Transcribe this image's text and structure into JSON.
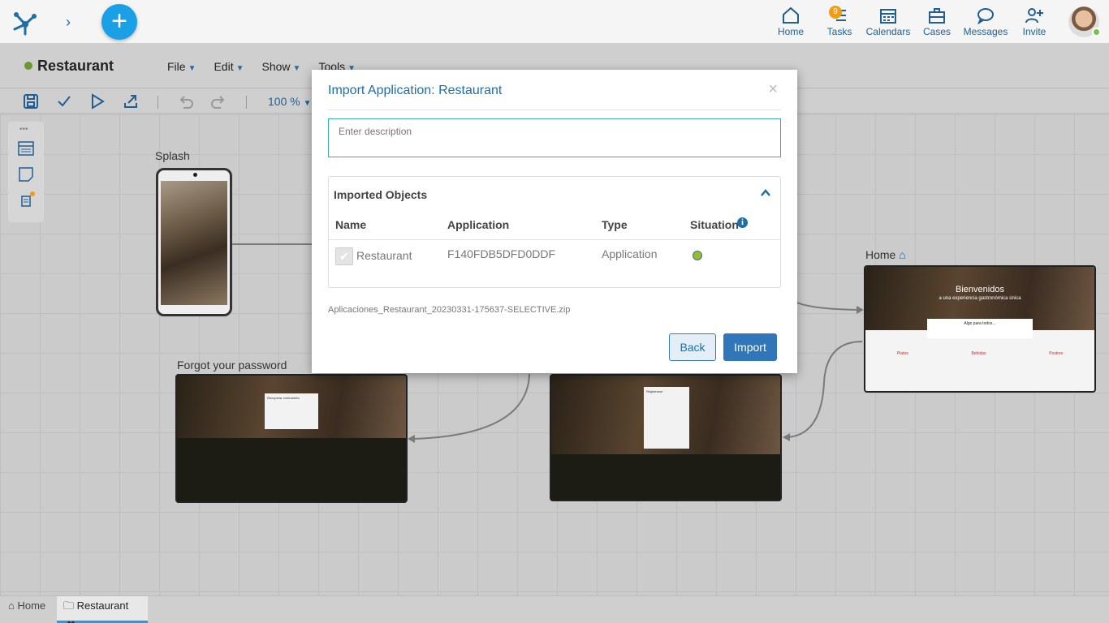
{
  "topbar": {
    "nav": [
      {
        "label": "Home",
        "icon": "home-icon"
      },
      {
        "label": "Tasks",
        "icon": "tasks-icon",
        "badge": "9"
      },
      {
        "label": "Calendars",
        "icon": "calendar-icon"
      },
      {
        "label": "Cases",
        "icon": "briefcase-icon"
      },
      {
        "label": "Messages",
        "icon": "message-icon"
      },
      {
        "label": "Invite",
        "icon": "invite-user-icon"
      }
    ],
    "add_label": "+"
  },
  "app": {
    "title": "Restaurant",
    "menus": [
      "File",
      "Edit",
      "Show",
      "Tools"
    ]
  },
  "toolbar": {
    "zoom": "100 %"
  },
  "canvas": {
    "nodes": {
      "splash": "Splash",
      "forgot": "Forgot your password",
      "home": "Home"
    },
    "home_hero_title": "Bienvenidos",
    "home_hero_subtitle": "a una experiencia gastronómica única",
    "home_card_title": "Algo para todos...",
    "home_features": [
      "Platos",
      "Bebidas",
      "Postres"
    ],
    "forgot_card_title": "Recuperar contraseña",
    "register_card_title": "Registrarse"
  },
  "modal": {
    "title": "Import Application: Restaurant",
    "close": "×",
    "description_placeholder": "Enter description",
    "panel_title": "Imported Objects",
    "columns": {
      "name": "Name",
      "application": "Application",
      "type": "Type",
      "situation": "Situation"
    },
    "row": {
      "name": "Restaurant",
      "application": "F140FDB5DFD0DDF",
      "type": "Application",
      "situation_color": "#8bbf3a"
    },
    "filename": "Aplicaciones_Restaurant_20230331-175637-SELECTIVE.zip",
    "back_label": "Back",
    "import_label": "Import"
  },
  "tabs": [
    {
      "label": "Home",
      "icon": "home-icon"
    },
    {
      "label": "Restaurant",
      "icon": "folder-icon",
      "active": true
    }
  ],
  "colors": {
    "accent": "#1aa0e6",
    "primary_button": "#3176b8",
    "link": "#1f6fa8",
    "status_green": "#6a9a2e"
  }
}
